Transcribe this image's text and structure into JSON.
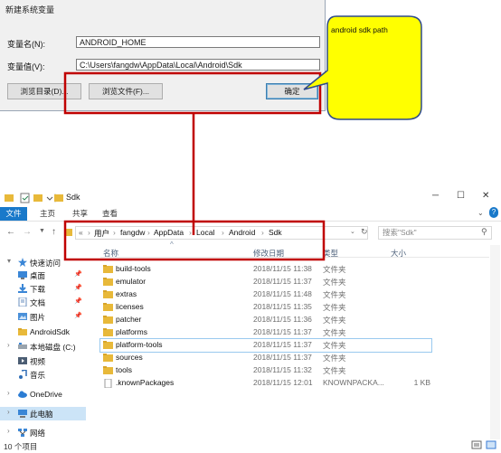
{
  "dialog": {
    "title": "新建系统变量",
    "name_label": "变量名(N):",
    "name_value": "ANDROID_HOME",
    "value_label": "变量值(V):",
    "value_value": "C:\\Users\\fangdw\\AppData\\Local\\Android\\Sdk",
    "browse_dir_label": "浏览目录(D)...",
    "browse_file_label": "浏览文件(F)...",
    "ok_label": "确定"
  },
  "callout": {
    "text": "android  sdk path",
    "fill": "#ffff00",
    "stroke": "#2e4a8a",
    "highlight_color": "#c00000"
  },
  "explorer": {
    "title": "Sdk",
    "tabs": [
      "文件",
      "主页",
      "共享",
      "查看"
    ],
    "breadcrumb": [
      "«",
      "用户",
      "fangdw",
      "AppData",
      "Local",
      "Android",
      "Sdk"
    ],
    "search_placeholder": "搜索\"Sdk\"",
    "columns": {
      "name": "名称",
      "date": "修改日期",
      "type": "类型",
      "size": "大小"
    },
    "nav": [
      {
        "label": "快速访问",
        "icon": "star-icon",
        "pinned": false
      },
      {
        "label": "桌面",
        "icon": "desktop-icon",
        "pinned": true
      },
      {
        "label": "下载",
        "icon": "download-icon",
        "pinned": true
      },
      {
        "label": "文档",
        "icon": "document-icon",
        "pinned": true
      },
      {
        "label": "图片",
        "icon": "picture-icon",
        "pinned": true
      },
      {
        "label": "AndroidSdk",
        "icon": "folder-icon",
        "pinned": false
      },
      {
        "label": "本地磁盘 (C:)",
        "icon": "drive-icon",
        "pinned": false
      },
      {
        "label": "视频",
        "icon": "video-icon",
        "pinned": false
      },
      {
        "label": "音乐",
        "icon": "music-icon",
        "pinned": false
      },
      {
        "label": "OneDrive",
        "icon": "cloud-icon",
        "pinned": false
      },
      {
        "label": "此电脑",
        "icon": "computer-icon",
        "pinned": false
      },
      {
        "label": "网络",
        "icon": "network-icon",
        "pinned": false
      }
    ],
    "files": [
      {
        "name": "build-tools",
        "date": "2018/11/15 11:38",
        "type": "文件夹",
        "size": ""
      },
      {
        "name": "emulator",
        "date": "2018/11/15 11:37",
        "type": "文件夹",
        "size": ""
      },
      {
        "name": "extras",
        "date": "2018/11/15 11:48",
        "type": "文件夹",
        "size": ""
      },
      {
        "name": "licenses",
        "date": "2018/11/15 11:35",
        "type": "文件夹",
        "size": ""
      },
      {
        "name": "patcher",
        "date": "2018/11/15 11:36",
        "type": "文件夹",
        "size": ""
      },
      {
        "name": "platforms",
        "date": "2018/11/15 11:37",
        "type": "文件夹",
        "size": ""
      },
      {
        "name": "platform-tools",
        "date": "2018/11/15 11:37",
        "type": "文件夹",
        "size": ""
      },
      {
        "name": "sources",
        "date": "2018/11/15 11:37",
        "type": "文件夹",
        "size": ""
      },
      {
        "name": "tools",
        "date": "2018/11/15 11:32",
        "type": "文件夹",
        "size": ""
      },
      {
        "name": ".knownPackages",
        "date": "2018/11/15 12:01",
        "type": "KNOWNPACKA...",
        "size": "1 KB"
      }
    ],
    "status": "10 个项目"
  }
}
